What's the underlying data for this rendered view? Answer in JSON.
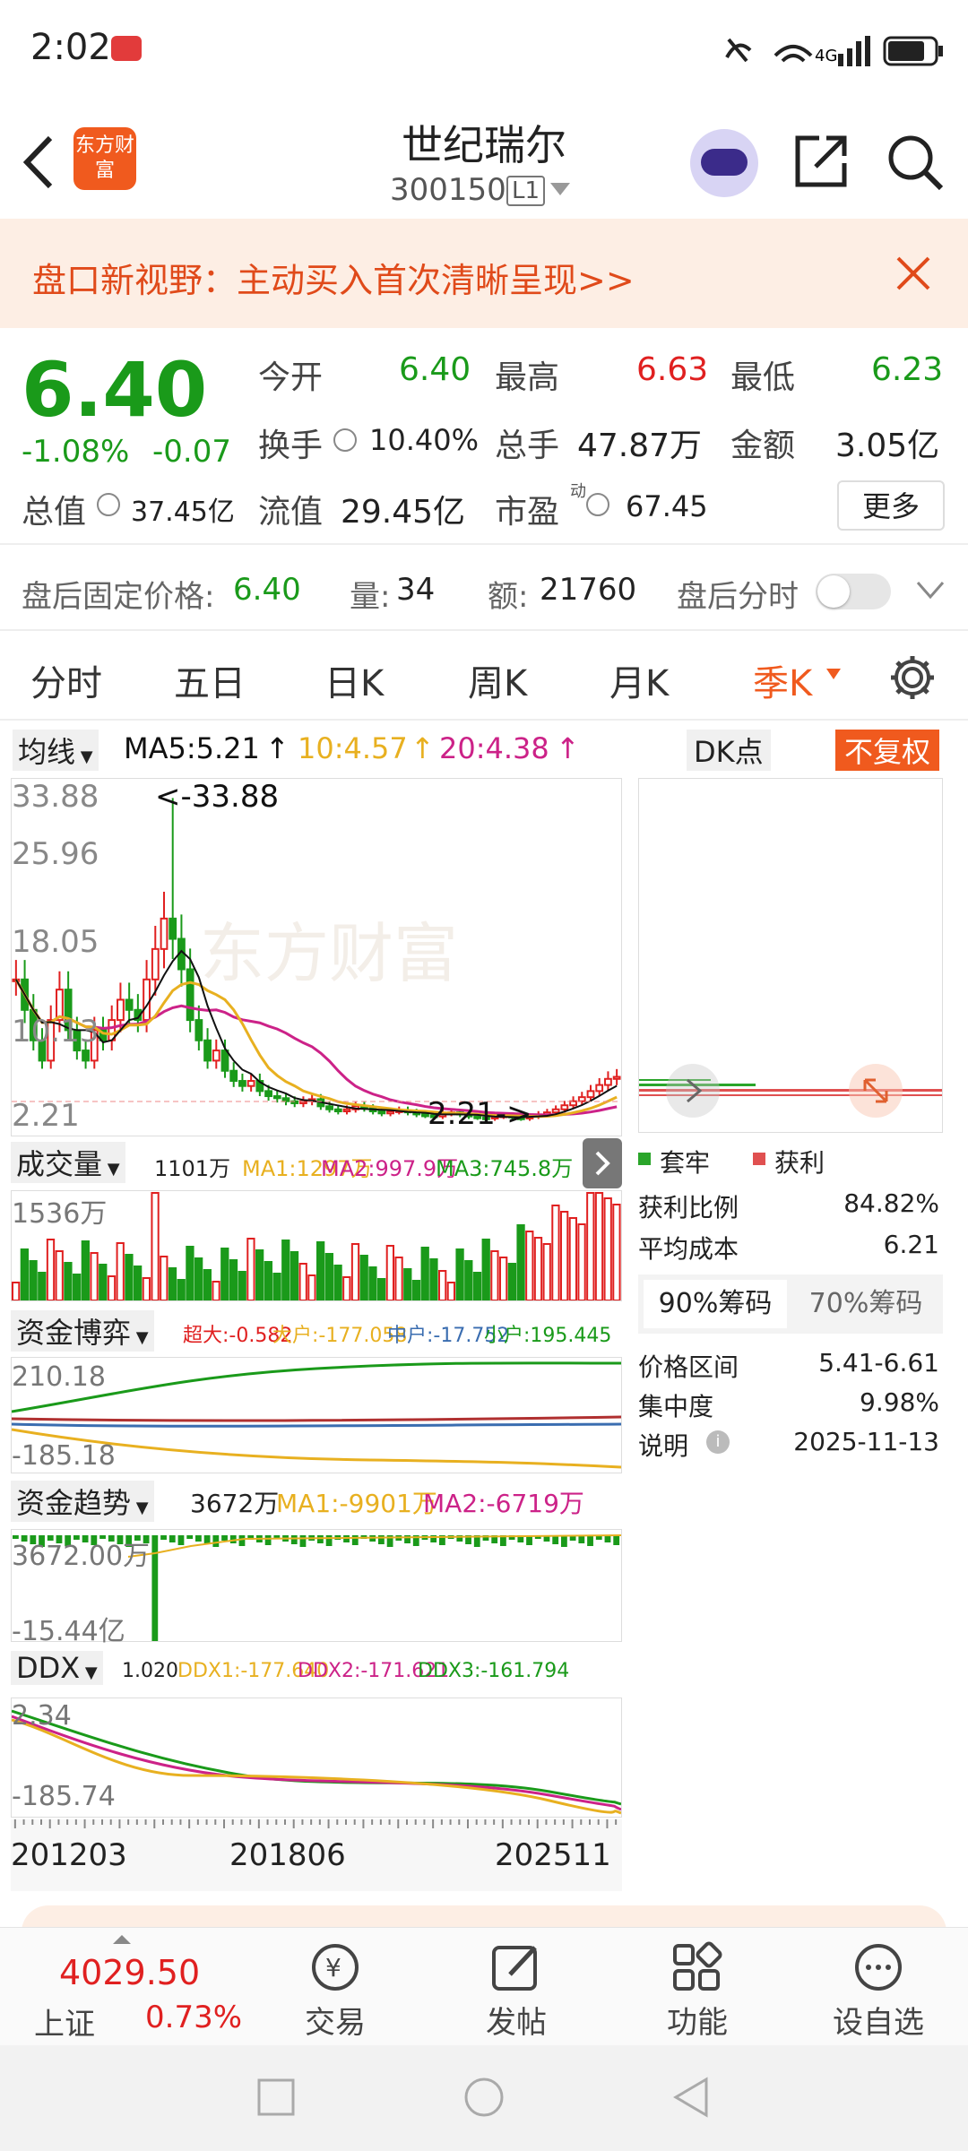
{
  "status": {
    "time": "2:02",
    "signal": "4G"
  },
  "header": {
    "title": "世纪瑞尔",
    "code": "300150",
    "level_badge": "L1",
    "logo_text": "东方财富"
  },
  "banner": {
    "text": "盘口新视野：主动买入首次清晰呈现>>"
  },
  "quote": {
    "price": "6.40",
    "change_pct": "-1.08%",
    "change": "-0.07",
    "open_label": "今开",
    "open": "6.40",
    "high_label": "最高",
    "high": "6.63",
    "low_label": "最低",
    "low": "6.23",
    "turnover_label": "换手",
    "turnover": "10.40%",
    "volume_label": "总手",
    "volume": "47.87万",
    "amount_label": "金额",
    "amount": "3.05亿",
    "mktcap_label": "总值",
    "mktcap": "37.45亿",
    "float_label": "流值",
    "float": "29.45亿",
    "pe_label": "市盈",
    "pe_sup": "动",
    "pe": "67.45",
    "more_button": "更多"
  },
  "after_hours": {
    "price_label": "盘后固定价格:",
    "price": "6.40",
    "vol_label": "量:",
    "vol": "34",
    "amt_label": "额:",
    "amt": "21760",
    "minute_label": "盘后分时"
  },
  "tabs": [
    "分时",
    "五日",
    "日K",
    "周K",
    "月K",
    "季K"
  ],
  "active_tab": "季K",
  "ma_bar": {
    "selector": "均线",
    "ma5": "MA5:5.21",
    "ma10": "10:4.57",
    "ma20": "20:4.38",
    "dk": "DK点",
    "adjust": "不复权"
  },
  "kline": {
    "max_label": "33.88",
    "max_note": "<-33.88",
    "l2": "25.96",
    "l3": "18.05",
    "l4": "10.13",
    "min_label": "2.21",
    "low_note": "2.21->",
    "watermark": "东方财富"
  },
  "volume_ind": {
    "name": "成交量",
    "v": "1101万",
    "ma1": "MA1:1297万",
    "ma2": "MA2:997.9万",
    "ma3": "MA3:745.8万",
    "top": "1536万"
  },
  "fund_game": {
    "name": "资金博弈",
    "super": "超大:-0.582",
    "big": "大户:-177.058",
    "mid": "中户:-17.752",
    "small": "小户:195.445",
    "top": "210.18",
    "bottom": "-185.18"
  },
  "fund_trend": {
    "name": "资金趋势",
    "v": "3672万",
    "ma1": "MA1:-9901万",
    "ma2": "MA2:-6719万",
    "top": "3672.00万",
    "bottom": "-15.44亿"
  },
  "ddx": {
    "name": "DDX",
    "v": "1.020",
    "ddx1": "DDX1:-177.640",
    "ddx2": "DDX2:-171.621",
    "ddx3": "DDX3:-161.794",
    "top": "2.34",
    "bottom": "-185.74"
  },
  "x_axis": [
    "201203",
    "201806",
    "202511"
  ],
  "chips": {
    "legend_trapped": "套牢",
    "legend_profit": "获利",
    "profit_ratio_label": "获利比例",
    "profit_ratio": "84.82%",
    "avg_cost_label": "平均成本",
    "avg_cost": "6.21",
    "tab90": "90%筹码",
    "tab70": "70%筹码",
    "range_label": "价格区间",
    "range": "5.41-6.61",
    "concentration_label": "集中度",
    "concentration": "9.98%",
    "desc_label": "说明",
    "desc": "2025-11-13"
  },
  "bottom_nav": {
    "index_value": "4029.50",
    "index_name": "上证",
    "index_pct": "0.73%",
    "trade": "交易",
    "post": "发帖",
    "features": "功能",
    "watchlist": "设自选"
  },
  "colors": {
    "up": "#e02020",
    "down": "#1a9a1a",
    "accent": "#f05a1e",
    "ma5": "#111111",
    "ma10": "#e8b020",
    "ma20": "#cc2288"
  },
  "icons": [
    "back-icon",
    "share-icon",
    "search-icon",
    "close-icon",
    "settings-icon",
    "chevron-down-icon",
    "trade-icon",
    "post-icon",
    "features-icon",
    "watchlist-icon"
  ]
}
